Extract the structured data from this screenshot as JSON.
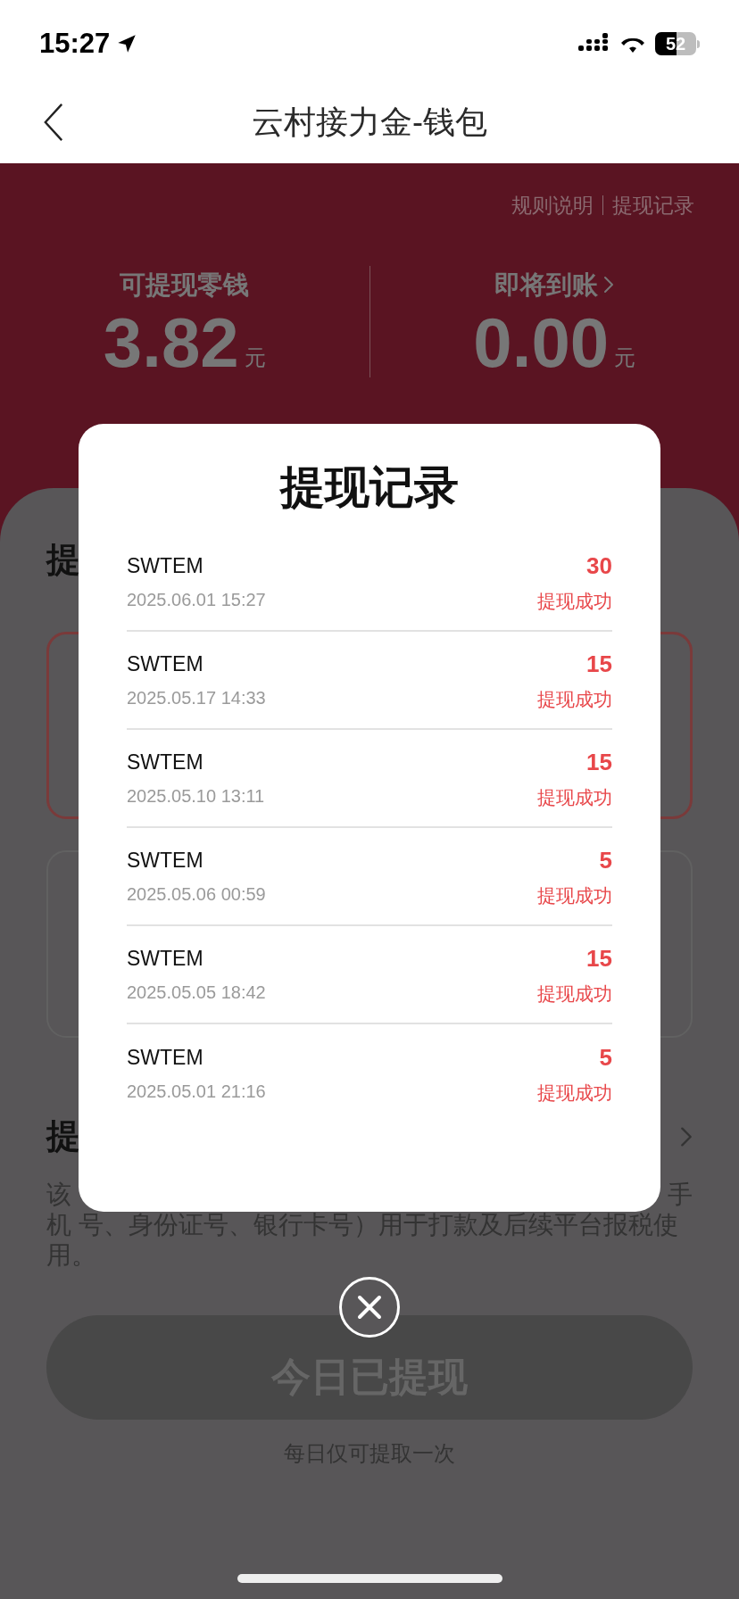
{
  "status_bar": {
    "time": "15:27",
    "battery": "52"
  },
  "nav": {
    "title": "云村接力金-钱包"
  },
  "wallet": {
    "links": [
      "规则说明",
      "提现记录"
    ],
    "stats": [
      {
        "label": "可提现零钱",
        "amount": "3.82",
        "unit": "元",
        "chevron": false
      },
      {
        "label": "即将到账",
        "amount": "0.00",
        "unit": "元",
        "chevron": true
      }
    ]
  },
  "section_1": {
    "heading_fragment": "提"
  },
  "section_2": {
    "heading_fragment": "提",
    "note_line_1_start": "该",
    "note_line_1_end": "手",
    "note_rest": "机 号、身份证号、银行卡号）用于打款及后续平台报税使用。"
  },
  "withdraw_button": {
    "label": "今日已提现",
    "disabled": true
  },
  "hint": "每日仅可提取一次",
  "modal": {
    "title": "提现记录",
    "records": [
      {
        "name": "SWTEM",
        "time": "2025.06.01 15:27",
        "amount": "30",
        "status": "提现成功"
      },
      {
        "name": "SWTEM",
        "time": "2025.05.17 14:33",
        "amount": "15",
        "status": "提现成功"
      },
      {
        "name": "SWTEM",
        "time": "2025.05.10 13:11",
        "amount": "15",
        "status": "提现成功"
      },
      {
        "name": "SWTEM",
        "time": "2025.05.06 00:59",
        "amount": "5",
        "status": "提现成功"
      },
      {
        "name": "SWTEM",
        "time": "2025.05.05 18:42",
        "amount": "15",
        "status": "提现成功"
      },
      {
        "name": "SWTEM",
        "time": "2025.05.01 21:16",
        "amount": "5",
        "status": "提现成功"
      }
    ]
  }
}
